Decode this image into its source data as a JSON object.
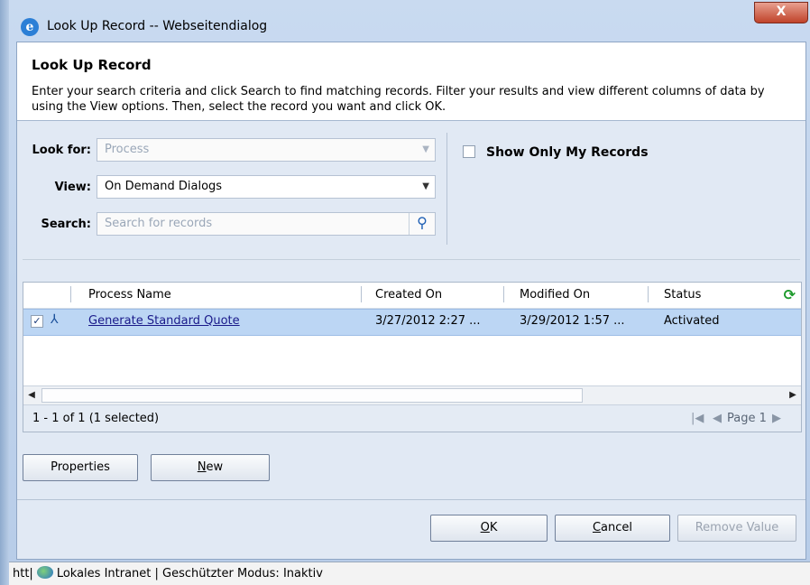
{
  "window": {
    "title": "Look Up Record -- Webseitendialog",
    "close_label": "X"
  },
  "header": {
    "title": "Look Up Record",
    "description": "Enter your search criteria and click Search to find matching records. Filter your results and view different columns of data by using the View options. Then, select the record you want and click OK."
  },
  "form": {
    "look_for_label": "Look for:",
    "look_for_value": "Process",
    "view_label": "View:",
    "view_value": "On Demand Dialogs",
    "search_label": "Search:",
    "search_placeholder": "Search for records",
    "show_only_my_records": "Show Only My Records"
  },
  "grid": {
    "columns": [
      "Process Name",
      "Created On",
      "Modified On",
      "Status"
    ],
    "rows": [
      {
        "name": "Generate Standard Quote",
        "created": "3/27/2012 2:27 ...",
        "modified": "3/29/2012 1:57 ...",
        "status": "Activated",
        "checked": true
      }
    ],
    "footer_count": "1 - 1 of 1 (1 selected)",
    "page_label": "Page 1"
  },
  "buttons": {
    "properties": "Properties",
    "new_prefix": "N",
    "new_suffix": "ew",
    "ok_prefix": "O",
    "ok_suffix": "K",
    "cancel_prefix": "C",
    "cancel_suffix": "ancel",
    "remove_value": "Remove Value"
  },
  "statusbar": {
    "left": "htt|",
    "text": "Lokales Intranet | Geschützter Modus: Inaktiv"
  }
}
